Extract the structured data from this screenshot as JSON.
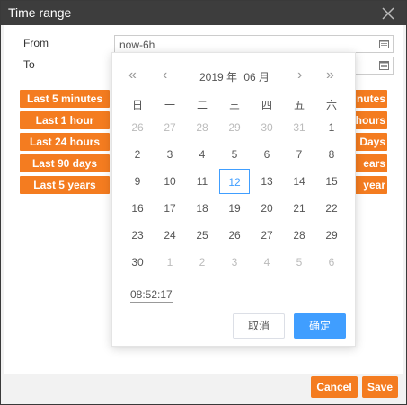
{
  "dialog": {
    "title": "Time range",
    "from_label": "From",
    "to_label": "To",
    "from_value": "now-6h",
    "to_value": ""
  },
  "quick_ranges_left": [
    "Last 5 minutes",
    "Last 1 hour",
    "Last 24 hours",
    "Last 90 days",
    "Last 5 years"
  ],
  "quick_ranges_right_partial": [
    "nutes",
    "hours",
    "Days",
    "ears",
    "year"
  ],
  "picker": {
    "year": "2019 年",
    "month": "06 月",
    "weekdays": [
      "日",
      "一",
      "二",
      "三",
      "四",
      "五",
      "六"
    ],
    "days": [
      [
        "26",
        "27",
        "28",
        "29",
        "30",
        "31",
        "1"
      ],
      [
        "2",
        "3",
        "4",
        "5",
        "6",
        "7",
        "8"
      ],
      [
        "9",
        "10",
        "11",
        "12",
        "13",
        "14",
        "15"
      ],
      [
        "16",
        "17",
        "18",
        "19",
        "20",
        "21",
        "22"
      ],
      [
        "23",
        "24",
        "25",
        "26",
        "27",
        "28",
        "29"
      ],
      [
        "30",
        "1",
        "2",
        "3",
        "4",
        "5",
        "6"
      ]
    ],
    "selected_day": "12",
    "time": "08:52:17",
    "cancel_label": "取消",
    "ok_label": "确定",
    "accent": "#409eff"
  },
  "footer": {
    "cancel_label": "Cancel",
    "save_label": "Save",
    "accent": "#f47c20"
  }
}
